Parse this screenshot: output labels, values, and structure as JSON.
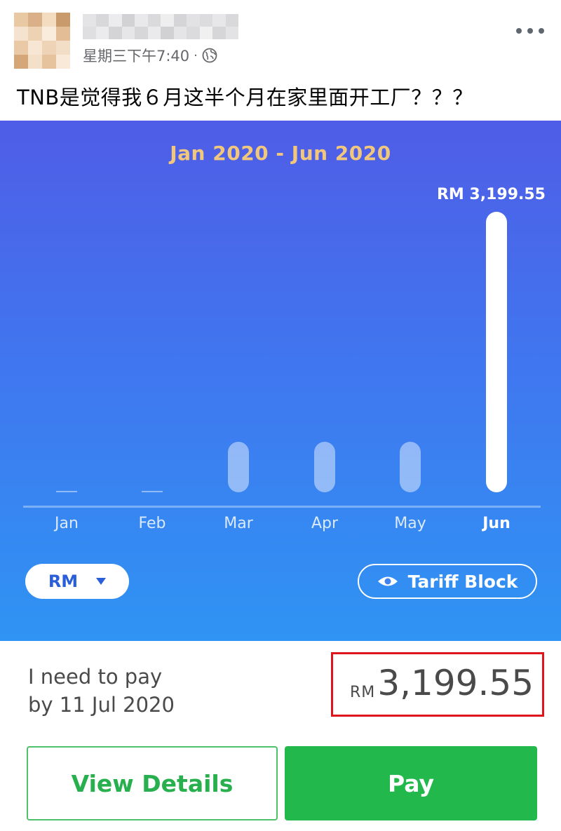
{
  "post": {
    "timestamp": "星期三下午7:40",
    "separator": "·",
    "audience_icon": "globe-icon",
    "more_icon": "more-options-icon",
    "caption": "TNB是觉得我６月这半个月在家里面开工厂？？？"
  },
  "app": {
    "range_title": "Jan 2020 - Jun 2020",
    "unit_toggle_label": "RM",
    "tariff_block_label": "Tariff Block",
    "pay_label": "I need to pay",
    "due_text": "by 11 Jul 2020",
    "amount_currency": "RM",
    "amount_value": "3,199.55",
    "view_details_label": "View Details",
    "pay_button_label": "Pay"
  },
  "chart_data": {
    "type": "bar",
    "categories": [
      "Jan",
      "Feb",
      "Mar",
      "Apr",
      "May",
      "Jun"
    ],
    "values": [
      0,
      0,
      240,
      240,
      240,
      3199.55
    ],
    "value_labels": [
      "",
      "",
      "",
      "",
      "",
      "RM 3,199.55"
    ],
    "title": "Jan 2020 - Jun 2020",
    "ylim": [
      0,
      3199.55
    ],
    "highlight_index": 5,
    "grid": false
  },
  "colors": {
    "accent_green": "#22b84c",
    "highlight_red": "#e0141c",
    "title_gold": "#f1c77d"
  }
}
